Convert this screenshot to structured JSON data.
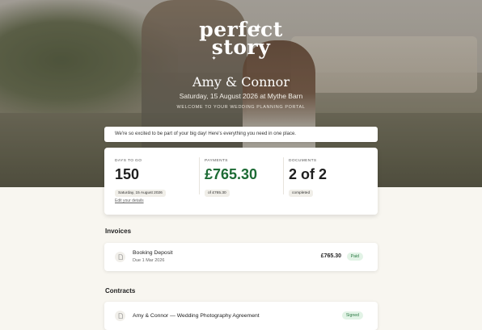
{
  "hero": {
    "logo_line1": "perfect",
    "logo_line2": "story",
    "couple": "Amy & Connor",
    "date_venue": "Saturday, 15 August 2026 at Mythe Barn",
    "welcome": "WELCOME TO YOUR WEDDING PLANNING PORTAL"
  },
  "notice": "We're so excited to be part of your big day! Here's everything you need in one place.",
  "stats": {
    "days": {
      "label": "DAYS TO GO",
      "value": "150",
      "pill": "Saturday, 15 August 2026"
    },
    "payments": {
      "label": "PAYMENTS",
      "value": "£765.30",
      "pill": "of £765.30"
    },
    "documents": {
      "label": "DOCUMENTS",
      "value": "2 of 2",
      "pill": "completed"
    },
    "edit_link": "Edit your details"
  },
  "invoices": {
    "title": "Invoices",
    "items": [
      {
        "name": "Booking Deposit",
        "due": "Due 1 Mar 2026",
        "amount": "£765.30",
        "status": "Paid"
      }
    ]
  },
  "contracts": {
    "title": "Contracts",
    "items": [
      {
        "name": "Amy & Connor — Wedding Photography Agreement",
        "status": "Signed"
      }
    ]
  },
  "colors": {
    "accent_green": "#1d6b35",
    "badge_bg": "#e2f3e6",
    "page_bg": "#f8f6f0"
  },
  "icons": {
    "document": "document-icon",
    "sparkle": "sparkle-icon"
  }
}
